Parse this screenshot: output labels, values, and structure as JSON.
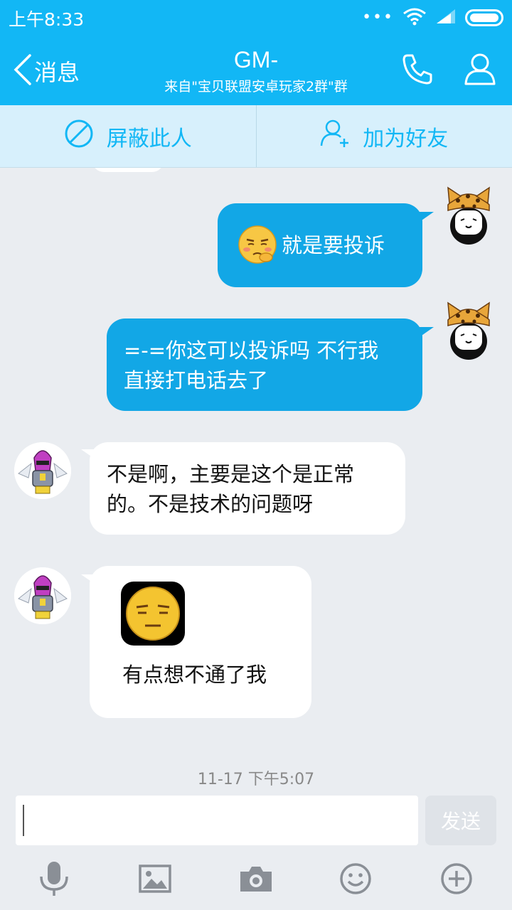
{
  "status": {
    "time": "上午8:33",
    "dots": "•••"
  },
  "header": {
    "back_label": "消息",
    "title": "GM-",
    "subtitle": "来自\"宝贝联盟安卓玩家2群\"群"
  },
  "actions": {
    "block_label": "屏蔽此人",
    "add_friend_label": "加为好友"
  },
  "messages": [
    {
      "side": "out",
      "text": "就是要投诉",
      "emoji": "thinking-emoji"
    },
    {
      "side": "out",
      "line1": "=-=你这可以投诉吗 不行我",
      "line2": "直接打电话去了"
    },
    {
      "side": "in",
      "line1": "不是啊，主要是这个是正常",
      "line2": "的。不是技术的问题呀"
    },
    {
      "side": "in",
      "text": "有点想不通了我",
      "emoji": "speechless-emoji"
    }
  ],
  "timestamp": "11-17 下午5:07",
  "input": {
    "value": "",
    "send_label": "发送"
  },
  "colors": {
    "brand": "#12b7f5",
    "bubble_out": "#12a7e6",
    "bg": "#eaedf1"
  },
  "toolbar_icons": [
    "microphone-icon",
    "image-icon",
    "camera-icon",
    "smiley-icon",
    "plus-icon"
  ]
}
